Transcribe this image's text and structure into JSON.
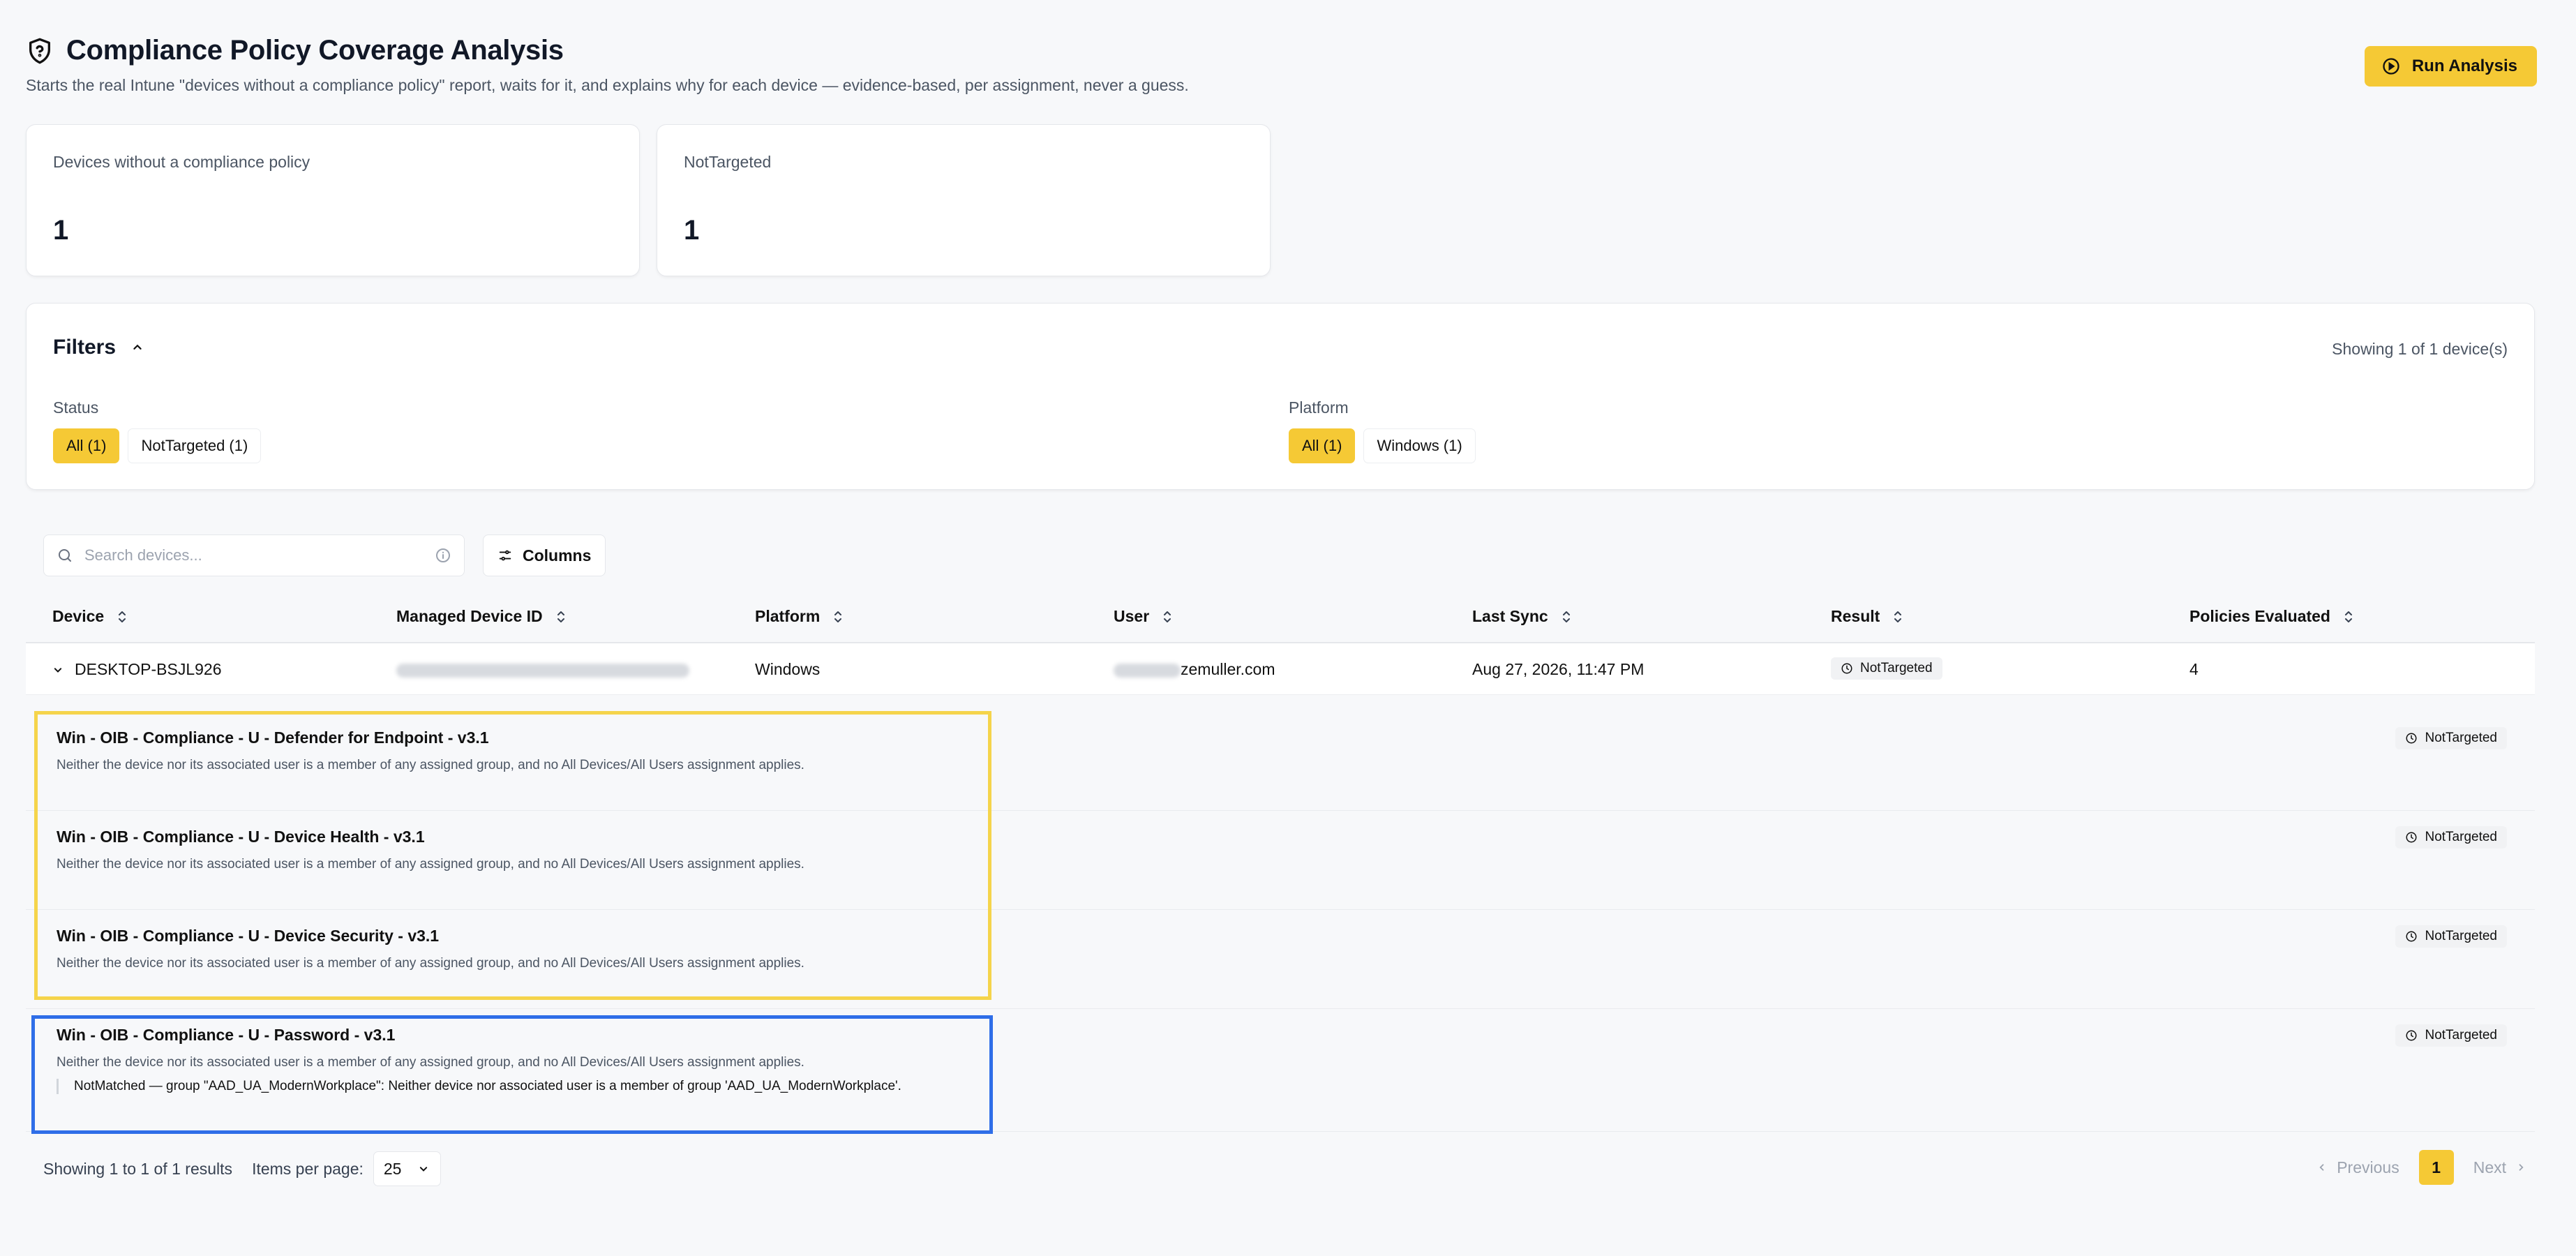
{
  "header": {
    "title": "Compliance Policy Coverage Analysis",
    "subtitle": "Starts the real Intune \"devices without a compliance policy\" report, waits for it, and explains why for each device — evidence-based, per assignment, never a guess.",
    "run_button": "Run Analysis"
  },
  "stats": [
    {
      "label": "Devices without a compliance policy",
      "value": "1"
    },
    {
      "label": "NotTargeted",
      "value": "1"
    }
  ],
  "filters": {
    "title": "Filters",
    "showing": "Showing 1 of 1 device(s)",
    "status_label": "Status",
    "status_chips": [
      "All (1)",
      "NotTargeted (1)"
    ],
    "platform_label": "Platform",
    "platform_chips": [
      "All (1)",
      "Windows (1)"
    ]
  },
  "toolbar": {
    "search_placeholder": "Search devices...",
    "columns_button": "Columns"
  },
  "table": {
    "columns": [
      "Device",
      "Managed Device ID",
      "Platform",
      "User",
      "Last Sync",
      "Result",
      "Policies Evaluated"
    ],
    "row": {
      "device": "DESKTOP-BSJL926",
      "platform": "Windows",
      "user_suffix": "zemuller.com",
      "last_sync": "Aug 27, 2026, 11:47 PM",
      "result": "NotTargeted",
      "policies_evaluated": "4"
    }
  },
  "policies": [
    {
      "name": "Win - OIB - Compliance - U - Defender for Endpoint - v3.1",
      "desc": "Neither the device nor its associated user is a member of any assigned group, and no All Devices/All Users assignment applies.",
      "result": "NotTargeted"
    },
    {
      "name": "Win - OIB - Compliance - U - Device Health - v3.1",
      "desc": "Neither the device nor its associated user is a member of any assigned group, and no All Devices/All Users assignment applies.",
      "result": "NotTargeted"
    },
    {
      "name": "Win - OIB - Compliance - U - Device Security - v3.1",
      "desc": "Neither the device nor its associated user is a member of any assigned group, and no All Devices/All Users assignment applies.",
      "result": "NotTargeted"
    },
    {
      "name": "Win - OIB - Compliance - U - Password - v3.1",
      "desc": "Neither the device nor its associated user is a member of any assigned group, and no All Devices/All Users assignment applies.",
      "result": "NotTargeted",
      "detail": "NotMatched — group \"AAD_UA_ModernWorkplace\": Neither device nor associated user is a member of group 'AAD_UA_ModernWorkplace'."
    }
  ],
  "footer": {
    "showing": "Showing 1 to 1 of 1 results",
    "per_page_label": "Items per page:",
    "per_page_value": "25",
    "previous": "Previous",
    "page": "1",
    "next": "Next"
  },
  "colors": {
    "accent": "#f5c935",
    "highlight_yellow": "#f5d44b",
    "highlight_blue": "#2f6ee8"
  }
}
